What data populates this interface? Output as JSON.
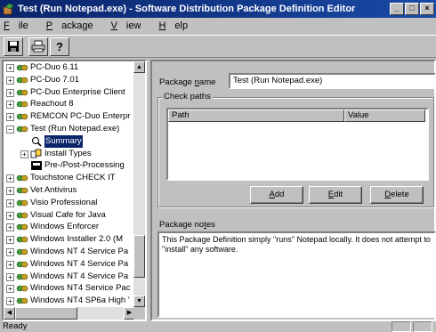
{
  "window": {
    "title": "Test (Run Notepad.exe) - Software Distribution Package Definition Editor",
    "buttons": [
      "_",
      "□",
      "×"
    ]
  },
  "menu": {
    "items": [
      {
        "label": "File",
        "accel": "F",
        "rest": "ile"
      },
      {
        "label": "Package",
        "accel": "P",
        "rest": "ackage"
      },
      {
        "label": "View",
        "accel": "V",
        "rest": "iew"
      },
      {
        "label": "Help",
        "accel": "H",
        "rest": "elp"
      }
    ]
  },
  "toolbar": {
    "buttons": [
      "save-icon",
      "print-icon",
      "help-icon"
    ]
  },
  "tree": {
    "items": [
      {
        "label": "PC-Duo 6.11",
        "level": 0,
        "expander": "+",
        "icon": "package-icon"
      },
      {
        "label": "PC-Duo 7.01",
        "level": 0,
        "expander": "+",
        "icon": "package-icon"
      },
      {
        "label": "PC-Duo Enterprise Client",
        "level": 0,
        "expander": "+",
        "icon": "package-icon"
      },
      {
        "label": "Reachout 8",
        "level": 0,
        "expander": "+",
        "icon": "package-icon"
      },
      {
        "label": "REMCON PC-Duo Enterpr",
        "level": 0,
        "expander": "+",
        "icon": "package-icon"
      },
      {
        "label": "Test (Run Notepad.exe)",
        "level": 0,
        "expander": "−",
        "icon": "package-icon"
      },
      {
        "label": "Summary",
        "level": 1,
        "expander": "",
        "icon": "summary-icon",
        "selected": true
      },
      {
        "label": "Install Types",
        "level": 1,
        "expander": "+",
        "icon": "install-types-icon"
      },
      {
        "label": "Pre-/Post-Processing",
        "level": 1,
        "expander": "",
        "icon": "processing-icon"
      },
      {
        "label": "Touchstone CHECK IT",
        "level": 0,
        "expander": "+",
        "icon": "package-icon"
      },
      {
        "label": "Vet Antivirus",
        "level": 0,
        "expander": "+",
        "icon": "package-icon"
      },
      {
        "label": "Visio Professional",
        "level": 0,
        "expander": "+",
        "icon": "package-icon"
      },
      {
        "label": "Visual Cafe for Java",
        "level": 0,
        "expander": "+",
        "icon": "package-icon"
      },
      {
        "label": "Windows Enforcer",
        "level": 0,
        "expander": "+",
        "icon": "package-icon"
      },
      {
        "label": "Windows Installer 2.0 (M",
        "level": 0,
        "expander": "+",
        "icon": "package-icon"
      },
      {
        "label": "Windows NT 4 Service Pa",
        "level": 0,
        "expander": "+",
        "icon": "package-icon"
      },
      {
        "label": "Windows NT 4 Service Pa",
        "level": 0,
        "expander": "+",
        "icon": "package-icon"
      },
      {
        "label": "Windows NT 4 Service Pa",
        "level": 0,
        "expander": "+",
        "icon": "package-icon"
      },
      {
        "label": "Windows NT4 Service Pac",
        "level": 0,
        "expander": "+",
        "icon": "package-icon"
      },
      {
        "label": "Windows NT4 SP6a High '",
        "level": 0,
        "expander": "+",
        "icon": "package-icon"
      }
    ]
  },
  "details": {
    "package_name_label": {
      "pre": "Package ",
      "accel": "n",
      "post": "ame"
    },
    "package_name_value": "Test (Run Notepad.exe)",
    "check_paths_title": "Check paths",
    "columns": [
      "Path",
      "Value"
    ],
    "add_button": {
      "accel": "A",
      "rest": "dd"
    },
    "edit_button": {
      "accel": "E",
      "rest": "dit"
    },
    "delete_button": {
      "accel": "D",
      "rest": "elete"
    },
    "notes_label": {
      "pre": "Package no",
      "accel": "t",
      "post": "es"
    },
    "notes_value": "This Package Definition simply \"runs\" Notepad locally. It does not attempt to \"install\" any software."
  },
  "status": {
    "text": "Ready"
  }
}
